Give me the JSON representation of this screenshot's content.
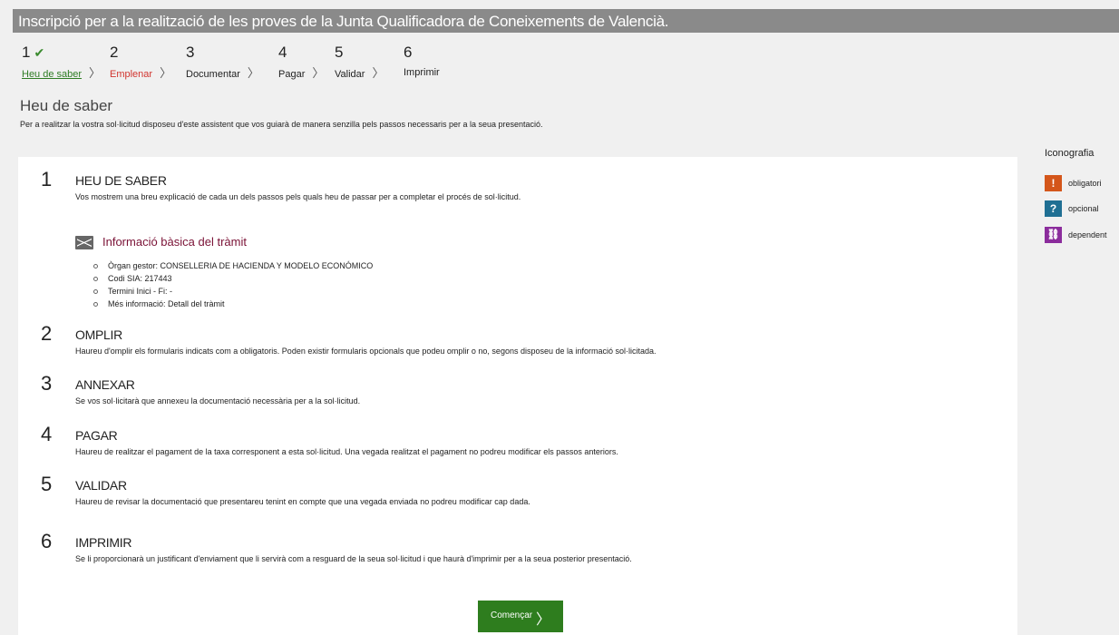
{
  "header": {
    "title": "Inscripció per a la realització de les proves de la Junta Qualificadora de Coneixements de Valencià."
  },
  "steps": [
    {
      "number": "1",
      "label": "Heu de saber",
      "state": "done"
    },
    {
      "number": "2",
      "label": "Emplenar",
      "state": "active"
    },
    {
      "number": "3",
      "label": "Documentar",
      "state": "pending"
    },
    {
      "number": "4",
      "label": "Pagar",
      "state": "pending"
    },
    {
      "number": "5",
      "label": "Validar",
      "state": "pending"
    },
    {
      "number": "6",
      "label": "Imprimir",
      "state": "pending"
    }
  ],
  "page": {
    "heading": "Heu de saber",
    "intro": "Per a realitzar la vostra sol·licitud disposeu d'este assistent que vos guiarà de manera senzilla pels passos necessaris per a la seua presentació."
  },
  "sections": [
    {
      "number": "1",
      "title": "HEU DE SABER",
      "description": "Vos mostrem una breu explicació de cada un dels passos pels quals heu de passar per a completar el procés de sol·licitud."
    },
    {
      "number": "2",
      "title": "OMPLIR",
      "description": "Haureu d'omplir els formularis indicats com a obligatoris. Poden existir formularis opcionals que podeu omplir o no, segons disposeu de la informació sol·licitada."
    },
    {
      "number": "3",
      "title": "ANNEXAR",
      "description": "Se vos sol·licitarà que annexeu la documentació necessària per a la sol·licitud."
    },
    {
      "number": "4",
      "title": "PAGAR",
      "description": "Haureu de realitzar el pagament de la taxa corresponent a esta sol·licitud. Una vegada realitzat el pagament no podreu modificar els passos anteriors."
    },
    {
      "number": "5",
      "title": "VALIDAR",
      "description": "Haureu de revisar la documentació que presentareu tenint en compte que una vegada enviada no podreu modificar cap dada."
    },
    {
      "number": "6",
      "title": "IMPRIMIR",
      "description": "Se li proporcionarà un justificant d'enviament que li servirà com a resguard de la seua sol·licitud i que haurà d'imprimir per a la seua posterior presentació."
    }
  ],
  "info": {
    "title": "Informació bàsica del tràmit",
    "items": [
      "Òrgan gestor: CONSELLERIA DE HACIENDA Y MODELO ECONÓMICO",
      "Codi SIA: 217443",
      "Termini Inici - Fi: -",
      "Més informació: Detall del tràmit"
    ]
  },
  "button": {
    "label": "Començar"
  },
  "legend": {
    "title": "Iconografia",
    "items": [
      {
        "label": "obligatori",
        "color": "#d4561a",
        "icon": "exclamation-icon",
        "glyph": "!"
      },
      {
        "label": "opcional",
        "color": "#1f6f93",
        "icon": "question-icon",
        "glyph": "?"
      },
      {
        "label": "dependent",
        "color": "#8b2c9c",
        "icon": "link-icon",
        "glyph": "🔗"
      }
    ]
  },
  "colors": {
    "header_bg": "#8a8a8a",
    "done_step": "#2f7d25",
    "active_step": "#d1342e",
    "button_bg": "#2e7d1e",
    "info_title": "#7a1236"
  }
}
